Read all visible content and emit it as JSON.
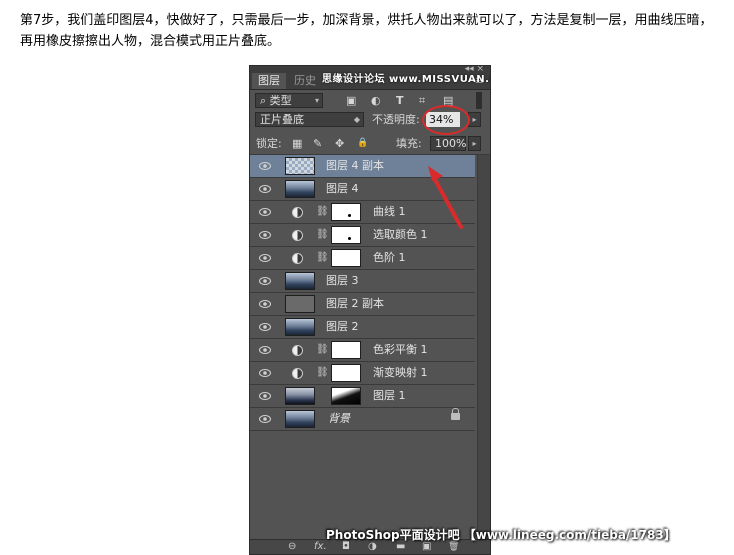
{
  "article": {
    "text": "第7步，我们盖印图层4，快做好了，只需最后一步，加深背景，烘托人物出来就可以了，方法是复制一层，用曲线压暗，再用橡皮擦擦出人物，混合模式用正片叠底。"
  },
  "panel": {
    "collapse": "◂◂ ×",
    "tabs": {
      "active": "图层",
      "inactive": "历史",
      "menu": "≡"
    },
    "watermark_top": "思缘设计论坛 www.MISSVUAN.COM",
    "filter": {
      "label": "类型",
      "search_icon": "⌕"
    },
    "filter_icons": [
      "image-filter-icon",
      "adjustment-filter-icon",
      "type-filter-icon",
      "shape-filter-icon",
      "smart-object-filter-icon"
    ],
    "filter_glyphs": [
      "▣",
      "◐",
      "T",
      "⌗",
      "▤"
    ],
    "blend_mode": "正片叠底",
    "opacity_label": "不透明度:",
    "opacity_value": "34%",
    "lock_label": "锁定:",
    "lock_glyphs": [
      "▦",
      "✎",
      "✥",
      "🔒"
    ],
    "fill_label": "填充:",
    "fill_value": "100%",
    "layers": [
      {
        "name": "图层 4 副本",
        "kind": "pixel",
        "thumb": "checker",
        "selected": true
      },
      {
        "name": "图层 4",
        "kind": "pixel",
        "thumb": "photo"
      },
      {
        "name": "曲线 1",
        "kind": "adjustment",
        "mask": "dot"
      },
      {
        "name": "选取颜色 1",
        "kind": "adjustment",
        "mask": "dot"
      },
      {
        "name": "色阶 1",
        "kind": "adjustment",
        "mask": "plain"
      },
      {
        "name": "图层 3",
        "kind": "pixel",
        "thumb": "photo"
      },
      {
        "name": "图层 2 副本",
        "kind": "pixel",
        "thumb": "gray"
      },
      {
        "name": "图层 2",
        "kind": "pixel",
        "thumb": "photo"
      },
      {
        "name": "色彩平衡 1",
        "kind": "adjustment",
        "mask": "plain"
      },
      {
        "name": "渐变映射 1",
        "kind": "adjustment",
        "mask": "plain"
      },
      {
        "name": "图层 1",
        "kind": "pixel-mask",
        "thumb": "photo-dark",
        "mask": "blk"
      },
      {
        "name": "背景",
        "kind": "background",
        "thumb": "photo",
        "locked": true
      }
    ],
    "bottom_icons": [
      "link-layers-icon",
      "fx-icon",
      "add-mask-icon",
      "adjustment-layer-icon",
      "group-icon",
      "new-layer-icon",
      "delete-icon"
    ],
    "bottom_glyphs": [
      "⊖",
      "fx.",
      "◘",
      "◑",
      "▬",
      "▣",
      "🗑"
    ]
  },
  "watermark_bottom": "PhotoShop平面设计吧 【www.lineeg.com/tieba/1783】",
  "colors": {
    "panel_bg": "#535353",
    "selected_row": "#6e8198",
    "annotation_red": "#d92b2b"
  }
}
